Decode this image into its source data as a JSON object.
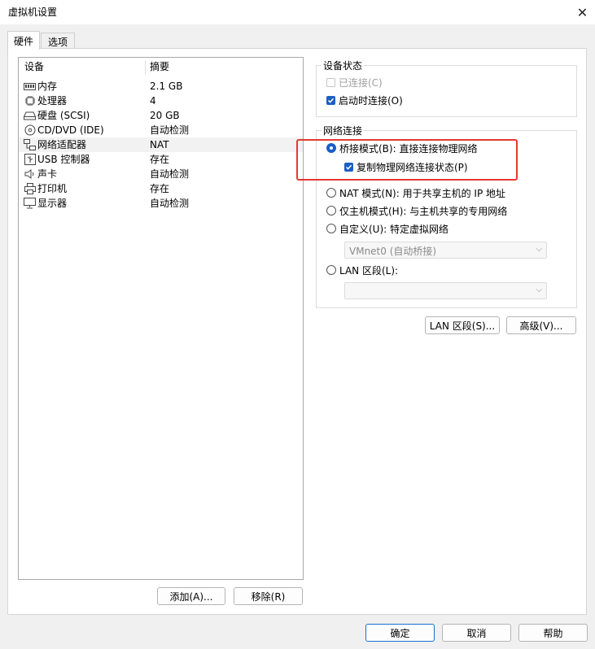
{
  "window": {
    "title": "虚拟机设置",
    "close_glyph": "✕"
  },
  "tabs": [
    {
      "label": "硬件",
      "active": true
    },
    {
      "label": "选项",
      "active": false
    }
  ],
  "device_list": {
    "columns": [
      "设备",
      "摘要"
    ],
    "rows": [
      {
        "name": "内存",
        "summary": "2.1 GB",
        "icon": "memory-icon"
      },
      {
        "name": "处理器",
        "summary": "4",
        "icon": "processor-icon"
      },
      {
        "name": "硬盘 (SCSI)",
        "summary": "20 GB",
        "icon": "hard-disk-icon"
      },
      {
        "name": "CD/DVD (IDE)",
        "summary": "自动检测",
        "icon": "cd-dvd-icon"
      },
      {
        "name": "网络适配器",
        "summary": "NAT",
        "icon": "network-adapter-icon",
        "selected": true
      },
      {
        "name": "USB 控制器",
        "summary": "存在",
        "icon": "usb-icon"
      },
      {
        "name": "声卡",
        "summary": "自动检测",
        "icon": "sound-card-icon"
      },
      {
        "name": "打印机",
        "summary": "存在",
        "icon": "printer-icon"
      },
      {
        "name": "显示器",
        "summary": "自动检测",
        "icon": "monitor-icon"
      }
    ],
    "add_button": "添加(A)...",
    "remove_button": "移除(R)"
  },
  "device_status": {
    "title": "设备状态",
    "connected": {
      "label": "已连接(C)",
      "checked": false,
      "disabled": true
    },
    "connect_at_power_on": {
      "label": "启动时连接(O)",
      "checked": true
    }
  },
  "network_connection": {
    "title": "网络连接",
    "bridged": {
      "label": "桥接模式(B): 直接连接物理网络",
      "checked": true
    },
    "replicate_state": {
      "label": "复制物理网络连接状态(P)",
      "checked": true
    },
    "nat": {
      "label": "NAT 模式(N): 用于共享主机的 IP 地址",
      "checked": false
    },
    "host_only": {
      "label": "仅主机模式(H): 与主机共享的专用网络",
      "checked": false
    },
    "custom": {
      "label": "自定义(U): 特定虚拟网络",
      "checked": false
    },
    "custom_select_value": "VMnet0 (自动桥接)",
    "lan_segment": {
      "label": "LAN 区段(L):",
      "checked": false
    },
    "lan_segment_select_value": ""
  },
  "network_buttons": {
    "lan_segments": "LAN 区段(S)...",
    "advanced": "高级(V)..."
  },
  "footer": {
    "ok": "确定",
    "cancel": "取消",
    "help": "帮助"
  },
  "colors": {
    "accent": "#1a5fc6",
    "highlight_box": "#e53935",
    "selected_row": "#f2f2f2"
  }
}
